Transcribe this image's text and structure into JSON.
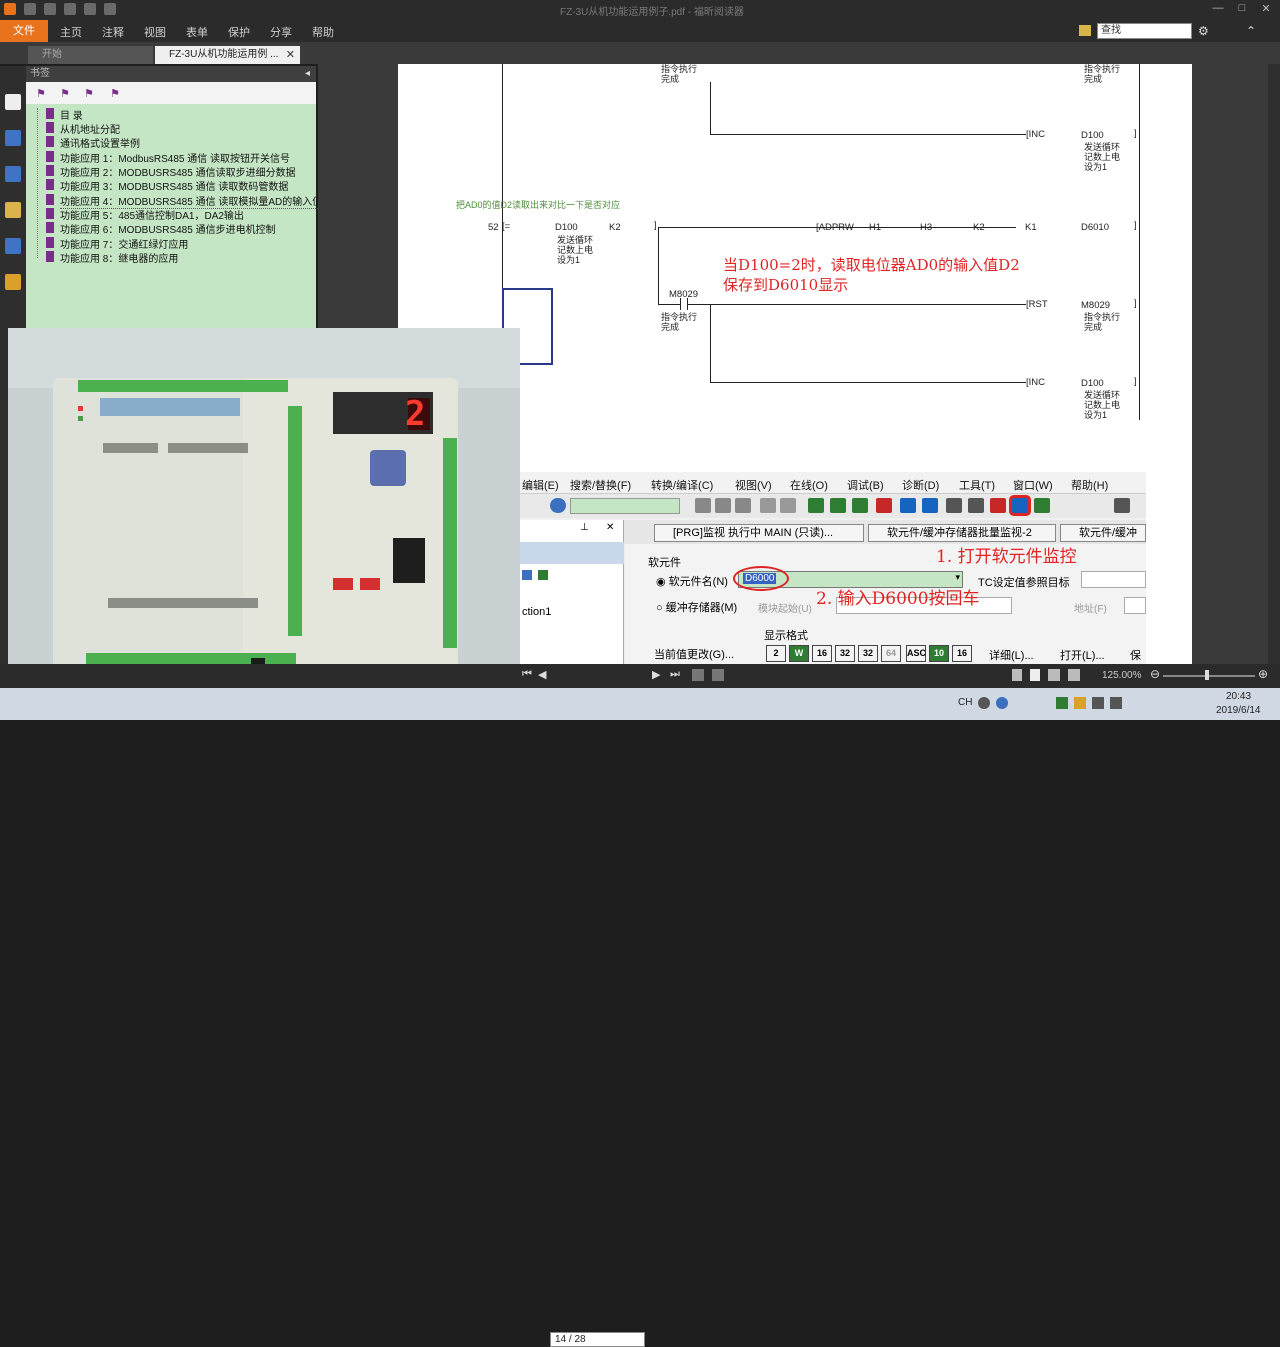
{
  "window": {
    "title": "FZ-3U从机功能运用例子.pdf - 福昕阅读器",
    "minimize": "—",
    "maximize": "□",
    "close": "✕"
  },
  "menubar": {
    "file": "文件",
    "items": [
      "主页",
      "注释",
      "视图",
      "表单",
      "保护",
      "分享",
      "帮助"
    ],
    "search_placeholder": "查找"
  },
  "tabs": [
    {
      "label": "开始"
    },
    {
      "label": "FZ-3U从机功能运用例 ..."
    }
  ],
  "bookmarks": {
    "header": "书签",
    "items": [
      "目 录",
      "从机地址分配",
      "通讯格式设置举例",
      "功能应用 1：ModbusRS485 通信 读取按钮开关信号",
      "功能应用 2：MODBUSRS485 通信读取步进细分数据",
      "功能应用 3：MODBUSRS485 通信 读取数码管数据",
      "功能应用 4：MODBUSRS485 通信 读取模拟量AD的输入值",
      "功能应用 5：485通信控制DA1，DA2输出",
      "功能应用 6：MODBUSRS485 通信步进电机控制",
      "功能应用 7：交通红绿灯应用",
      "功能应用 8：继电器的应用"
    ]
  },
  "ladder": {
    "comment_top_left": "指令执行\n完成",
    "comment_top_right": "指令执行\n完成",
    "inc_label": "INC",
    "d100": "D100",
    "d100_comment": "发送循环\n记数上电\n设为1",
    "rung_comment": "把AD0的值D2读取出来对比一下是否对应",
    "step": "52",
    "eq": "=",
    "k2": "K2",
    "adprw": "ADPRW",
    "h1": "H1",
    "h3": "H3",
    "k2b": "K2",
    "k1": "K1",
    "d6010": "D6010",
    "m8029": "M8029",
    "rst": "RST",
    "m8029b": "M8029",
    "annotation_line1": "当D100=2时，读取电位器AD0的输入值D2",
    "annotation_line2": "保存到D6010显示"
  },
  "gx": {
    "menu": [
      "编辑(E)",
      "搜索/替换(F)",
      "转换/编译(C)",
      "视图(V)",
      "在线(O)",
      "调试(B)",
      "诊断(D)",
      "工具(T)",
      "窗口(W)",
      "帮助(H)"
    ],
    "tabs": [
      "[PRG]监视 执行中 MAIN (只读)...",
      "软元件/缓冲存储器批量监视-2",
      "软元件/缓冲"
    ],
    "left_item": "ction1",
    "device_section": "软元件",
    "device_name_label": "软元件名(N)",
    "device_value": "D6000",
    "buffer_label": "缓冲存储器(M)",
    "module_start": "模块起始(U)",
    "tc_label": "TC设定值参照目标",
    "address_label": "地址(F)",
    "display_format": "显示格式",
    "current_change": "当前值更改(G)...",
    "detail": "详细(L)...",
    "open": "打开(L)...",
    "save": "保",
    "format_buttons": [
      "2",
      "W",
      "16",
      "32",
      "32",
      "64",
      "ASC",
      "10",
      "16"
    ],
    "step1": "1. 打开软元件监控",
    "step2": "2. 输入D6000按回车"
  },
  "device_display": "2",
  "status": {
    "page": "14 / 28",
    "zoom": "125.00%"
  },
  "taskbar": {
    "time": "20:43",
    "date": "2019/6/14",
    "ime": "CH"
  }
}
